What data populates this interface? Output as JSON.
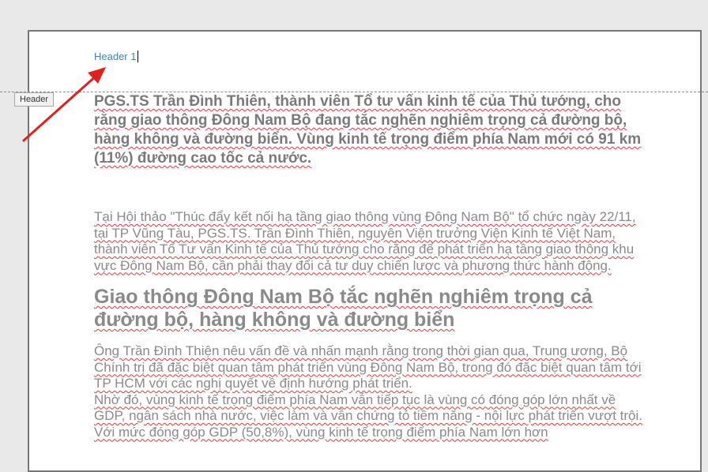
{
  "header": {
    "text": "Header 1",
    "tag_label": "Header"
  },
  "document": {
    "lead_paragraph": "PGS.TS Trần Đình Thiên, thành viên Tổ tư vấn kinh tế của Thủ tướng, cho rằng giao thông Đông Nam Bộ đang tắc nghẽn nghiêm trọng cả đường bộ, hàng không và đường biển. Vùng kinh tế trọng điểm phía Nam mới có 91 km (11%) đường cao tốc cả nước.",
    "paragraph_1": "Tại Hội thảo \"Thúc đẩy kết nối hạ tầng giao thông vùng Đông Nam Bộ\" tổ chức ngày 22/11, tại TP Vũng Tàu, PGS.TS. Trần Đình Thiên, nguyên Viện trưởng Viện Kinh tế Việt Nam, thành viên Tổ Tư vấn Kinh tế của Thủ tướng cho rằng để phát triển hạ tầng giao thông khu vực Đông Nam Bộ, cần phải thay đổi cả tư duy chiến lược và phương thức hành động.",
    "heading": "Giao thông Đông Nam Bộ tắc nghẽn nghiêm trọng cả đường bộ, hàng không và đường biển",
    "paragraph_2a": "Ông Trần Đình Thiện nêu vấn đề và nhấn mạnh rằng trong thời gian qua, Trung ương, Bộ Chính trị đã đặc biệt quan tâm phát triển vùng Đông Nam Bộ, trong đó đặc biệt quan tâm tới TP HCM với các nghị quyết về định hướng phát triển.",
    "paragraph_2b": "Nhờ đó, vùng kinh tế trọng điểm phía Nam vẫn tiếp tục là vùng có đóng góp lớn nhất về GDP, ngân sách nhà nước, việc làm và vẫn chứng tỏ tiềm năng - nội lực phát triển vượt trội. Với mức đóng góp GDP (50,8%), vùng kinh tế trọng điểm phía Nam lớn hơn"
  },
  "colors": {
    "header_text": "#3f84c0",
    "arrow": "#e0201c",
    "body_text": "#8a8a8a"
  }
}
